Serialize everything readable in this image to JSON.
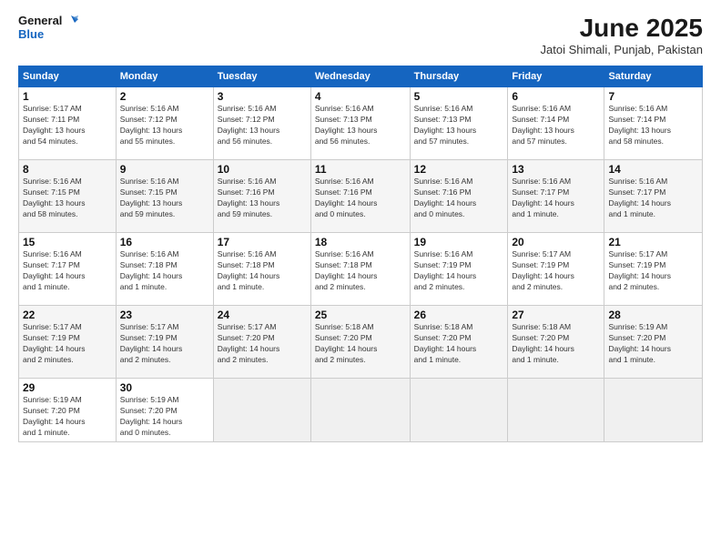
{
  "header": {
    "logo_line1": "General",
    "logo_line2": "Blue",
    "title": "June 2025",
    "subtitle": "Jatoi Shimali, Punjab, Pakistan"
  },
  "calendar": {
    "columns": [
      "Sunday",
      "Monday",
      "Tuesday",
      "Wednesday",
      "Thursday",
      "Friday",
      "Saturday"
    ],
    "weeks": [
      [
        {
          "day": "",
          "info": ""
        },
        {
          "day": "2",
          "info": "Sunrise: 5:16 AM\nSunset: 7:12 PM\nDaylight: 13 hours\nand 55 minutes."
        },
        {
          "day": "3",
          "info": "Sunrise: 5:16 AM\nSunset: 7:12 PM\nDaylight: 13 hours\nand 56 minutes."
        },
        {
          "day": "4",
          "info": "Sunrise: 5:16 AM\nSunset: 7:13 PM\nDaylight: 13 hours\nand 56 minutes."
        },
        {
          "day": "5",
          "info": "Sunrise: 5:16 AM\nSunset: 7:13 PM\nDaylight: 13 hours\nand 57 minutes."
        },
        {
          "day": "6",
          "info": "Sunrise: 5:16 AM\nSunset: 7:14 PM\nDaylight: 13 hours\nand 57 minutes."
        },
        {
          "day": "7",
          "info": "Sunrise: 5:16 AM\nSunset: 7:14 PM\nDaylight: 13 hours\nand 58 minutes."
        }
      ],
      [
        {
          "day": "1",
          "info": "Sunrise: 5:17 AM\nSunset: 7:11 PM\nDaylight: 13 hours\nand 54 minutes."
        },
        {
          "day": "9",
          "info": "Sunrise: 5:16 AM\nSunset: 7:15 PM\nDaylight: 13 hours\nand 59 minutes."
        },
        {
          "day": "10",
          "info": "Sunrise: 5:16 AM\nSunset: 7:16 PM\nDaylight: 13 hours\nand 59 minutes."
        },
        {
          "day": "11",
          "info": "Sunrise: 5:16 AM\nSunset: 7:16 PM\nDaylight: 14 hours\nand 0 minutes."
        },
        {
          "day": "12",
          "info": "Sunrise: 5:16 AM\nSunset: 7:16 PM\nDaylight: 14 hours\nand 0 minutes."
        },
        {
          "day": "13",
          "info": "Sunrise: 5:16 AM\nSunset: 7:17 PM\nDaylight: 14 hours\nand 1 minute."
        },
        {
          "day": "14",
          "info": "Sunrise: 5:16 AM\nSunset: 7:17 PM\nDaylight: 14 hours\nand 1 minute."
        }
      ],
      [
        {
          "day": "8",
          "info": "Sunrise: 5:16 AM\nSunset: 7:15 PM\nDaylight: 13 hours\nand 58 minutes."
        },
        {
          "day": "16",
          "info": "Sunrise: 5:16 AM\nSunset: 7:18 PM\nDaylight: 14 hours\nand 1 minute."
        },
        {
          "day": "17",
          "info": "Sunrise: 5:16 AM\nSunset: 7:18 PM\nDaylight: 14 hours\nand 1 minute."
        },
        {
          "day": "18",
          "info": "Sunrise: 5:16 AM\nSunset: 7:18 PM\nDaylight: 14 hours\nand 2 minutes."
        },
        {
          "day": "19",
          "info": "Sunrise: 5:16 AM\nSunset: 7:19 PM\nDaylight: 14 hours\nand 2 minutes."
        },
        {
          "day": "20",
          "info": "Sunrise: 5:17 AM\nSunset: 7:19 PM\nDaylight: 14 hours\nand 2 minutes."
        },
        {
          "day": "21",
          "info": "Sunrise: 5:17 AM\nSunset: 7:19 PM\nDaylight: 14 hours\nand 2 minutes."
        }
      ],
      [
        {
          "day": "15",
          "info": "Sunrise: 5:16 AM\nSunset: 7:17 PM\nDaylight: 14 hours\nand 1 minute."
        },
        {
          "day": "23",
          "info": "Sunrise: 5:17 AM\nSunset: 7:19 PM\nDaylight: 14 hours\nand 2 minutes."
        },
        {
          "day": "24",
          "info": "Sunrise: 5:17 AM\nSunset: 7:20 PM\nDaylight: 14 hours\nand 2 minutes."
        },
        {
          "day": "25",
          "info": "Sunrise: 5:18 AM\nSunset: 7:20 PM\nDaylight: 14 hours\nand 2 minutes."
        },
        {
          "day": "26",
          "info": "Sunrise: 5:18 AM\nSunset: 7:20 PM\nDaylight: 14 hours\nand 1 minute."
        },
        {
          "day": "27",
          "info": "Sunrise: 5:18 AM\nSunset: 7:20 PM\nDaylight: 14 hours\nand 1 minute."
        },
        {
          "day": "28",
          "info": "Sunrise: 5:19 AM\nSunset: 7:20 PM\nDaylight: 14 hours\nand 1 minute."
        }
      ],
      [
        {
          "day": "22",
          "info": "Sunrise: 5:17 AM\nSunset: 7:19 PM\nDaylight: 14 hours\nand 2 minutes."
        },
        {
          "day": "30",
          "info": "Sunrise: 5:19 AM\nSunset: 7:20 PM\nDaylight: 14 hours\nand 0 minutes."
        },
        {
          "day": "",
          "info": ""
        },
        {
          "day": "",
          "info": ""
        },
        {
          "day": "",
          "info": ""
        },
        {
          "day": "",
          "info": ""
        },
        {
          "day": "",
          "info": ""
        }
      ],
      [
        {
          "day": "29",
          "info": "Sunrise: 5:19 AM\nSunset: 7:20 PM\nDaylight: 14 hours\nand 1 minute."
        },
        {
          "day": "",
          "info": ""
        },
        {
          "day": "",
          "info": ""
        },
        {
          "day": "",
          "info": ""
        },
        {
          "day": "",
          "info": ""
        },
        {
          "day": "",
          "info": ""
        },
        {
          "day": "",
          "info": ""
        }
      ]
    ]
  }
}
